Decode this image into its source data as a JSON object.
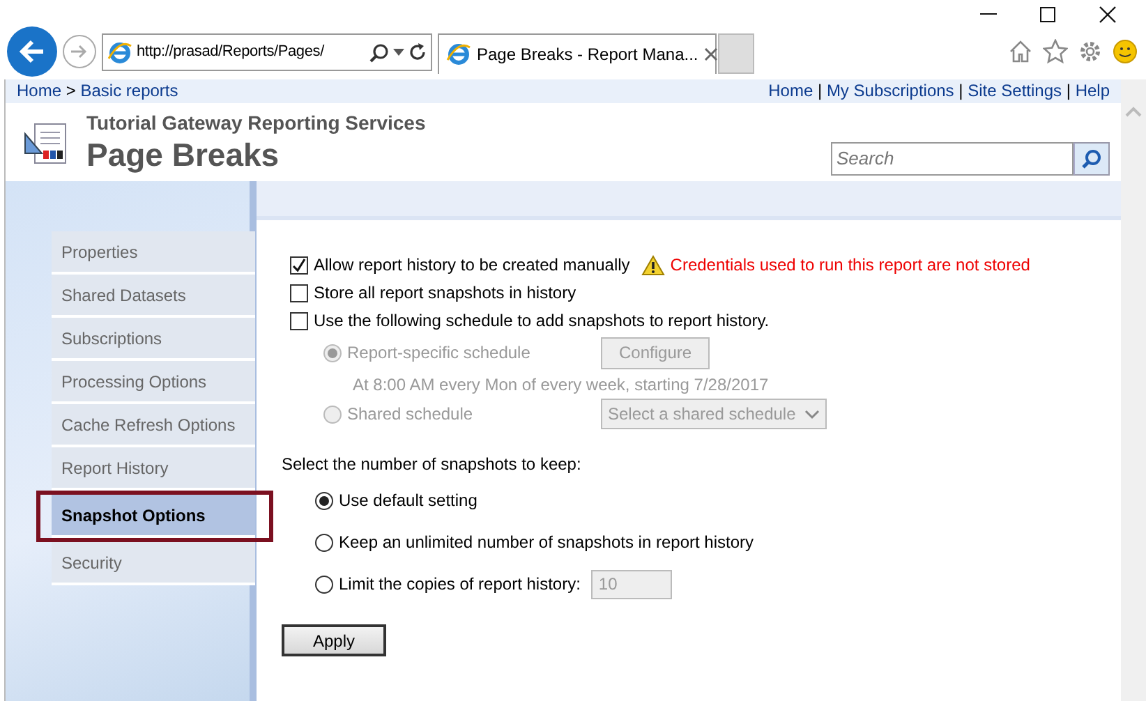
{
  "browser": {
    "url": "http://prasad/Reports/Pages/",
    "tab_title": "Page Breaks - Report Mana..."
  },
  "breadcrumb": {
    "items": [
      "Home",
      "Basic reports"
    ],
    "separator": ">"
  },
  "top_links": {
    "items": [
      "Home",
      "My Subscriptions",
      "Site Settings",
      "Help"
    ],
    "separator": "|"
  },
  "header": {
    "subtitle": "Tutorial Gateway Reporting Services",
    "title": "Page Breaks",
    "search": {
      "placeholder": "Search"
    }
  },
  "sidebar": {
    "items": [
      {
        "label": "Properties",
        "selected": false
      },
      {
        "label": "Shared Datasets",
        "selected": false
      },
      {
        "label": "Subscriptions",
        "selected": false
      },
      {
        "label": "Processing Options",
        "selected": false
      },
      {
        "label": "Cache Refresh Options",
        "selected": false
      },
      {
        "label": "Report History",
        "selected": false
      },
      {
        "label": "Snapshot Options",
        "selected": true
      },
      {
        "label": "Security",
        "selected": false
      }
    ]
  },
  "history_options": [
    {
      "label": "Allow report history to be created manually",
      "checked": true,
      "warning": "Credentials used to run this report are not stored"
    },
    {
      "label": "Store all report snapshots in history",
      "checked": false
    },
    {
      "label": "Use the following schedule to add snapshots to report history.",
      "checked": false
    }
  ],
  "schedule": {
    "disabled": true,
    "options": [
      {
        "kind": "button",
        "label": "Report-specific schedule",
        "selected": true,
        "button": "Configure",
        "description": "At 8:00 AM every Mon of every week, starting 7/28/2017"
      },
      {
        "kind": "select",
        "label": "Shared schedule",
        "selected": false,
        "select": "Select a shared schedule"
      }
    ]
  },
  "snapshots": {
    "heading": "Select the number of snapshots to keep:",
    "options": [
      {
        "kind": "plain",
        "label": "Use default setting",
        "selected": true
      },
      {
        "kind": "plain",
        "label": "Keep an unlimited number of snapshots in report history",
        "selected": false
      },
      {
        "kind": "limit",
        "label": "Limit the copies of report history:",
        "selected": false,
        "value": "10",
        "disabled": true
      }
    ]
  },
  "apply_button": "Apply"
}
